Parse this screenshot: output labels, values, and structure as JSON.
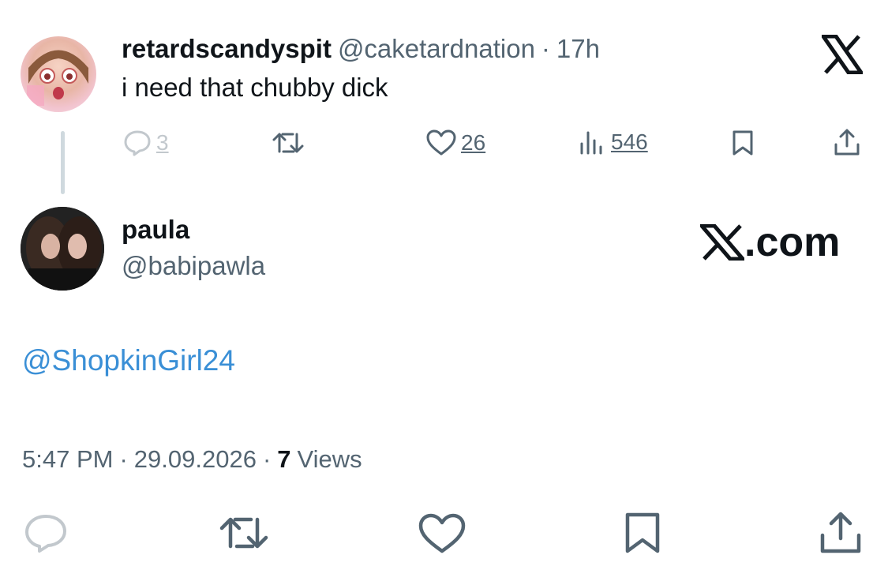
{
  "reply_tweet": {
    "display_name": "retardscandyspit",
    "handle": "@caketardnation",
    "separator": "·",
    "time": "17h",
    "text": "i need that chubby dick",
    "replies": "3",
    "likes": "26",
    "views": "546"
  },
  "main_tweet": {
    "display_name": "paula",
    "handle": "@babipawla",
    "mention": "@ShopkinGirl24",
    "time": "5:47 PM",
    "date": "29.09.2026",
    "views_count": "7",
    "views_label": "Views",
    "separator": "·"
  },
  "watermark": {
    "domain": ".com"
  },
  "colors": {
    "link": "#3a8fd6",
    "muted": "#536471",
    "text": "#0f1419",
    "thread_line": "#cfd9de"
  },
  "icons": [
    "x-logo-icon",
    "reply-icon",
    "retweet-icon",
    "like-icon",
    "views-icon",
    "bookmark-icon",
    "share-icon"
  ]
}
